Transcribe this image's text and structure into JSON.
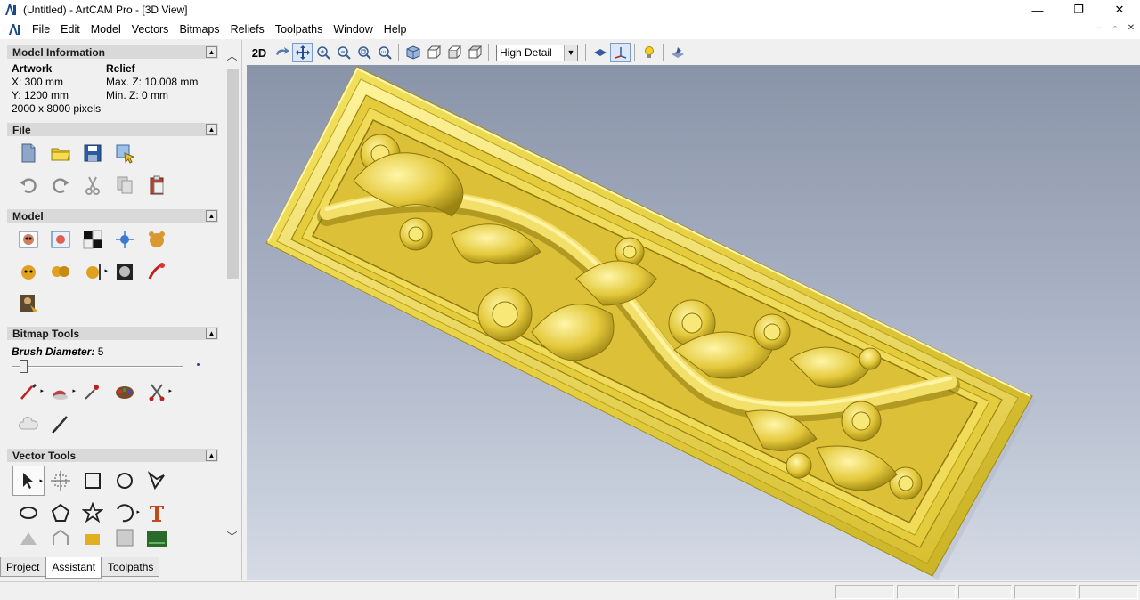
{
  "window": {
    "title": "(Untitled) - ArtCAM Pro - [3D View]",
    "minimize": "—",
    "maximize": "❐",
    "close": "✕"
  },
  "menu": [
    "File",
    "Edit",
    "Model",
    "Vectors",
    "Bitmaps",
    "Reliefs",
    "Toolpaths",
    "Window",
    "Help"
  ],
  "mdi_buttons": [
    "–",
    "▫",
    "✕"
  ],
  "model_info": {
    "header": "Model Information",
    "artwork_head": "Artwork",
    "artwork_x": "X: 300 mm",
    "artwork_y": "Y: 1200 mm",
    "relief_head": "Relief",
    "relief_max": "Max. Z: 10.008 mm",
    "relief_min": "Min. Z: 0 mm",
    "pixels": "2000 x 8000 pixels"
  },
  "sections": {
    "file": "File",
    "model": "Model",
    "bitmap_tools": "Bitmap Tools",
    "vector_tools": "Vector Tools"
  },
  "collapse_glyph": "▲",
  "brush": {
    "label": "Brush Diameter:",
    "value": "5",
    "level": 0.05
  },
  "tabs": [
    "Project",
    "Assistant",
    "Toolpaths"
  ],
  "toolbar": {
    "view_2d": "2D",
    "detail_select": "High Detail"
  },
  "icons": {
    "file": [
      "new-file-icon",
      "open-folder-icon",
      "save-icon",
      "import-icon",
      "undo-icon",
      "redo-icon",
      "cut-icon",
      "copy-icon",
      "paste-icon"
    ],
    "model": [
      "model-size-icon",
      "model-resolution-icon",
      "checker-icon",
      "position-icon",
      "bear-relief-icon",
      "relief-bear-icon",
      "relief-tile-icon",
      "relief-flip-icon",
      "grayscale-icon",
      "paint-icon",
      "mona-lisa-icon"
    ],
    "bitmap": [
      "pen-icon",
      "brush-icon",
      "dropper-icon",
      "palette-icon",
      "scissors-icon",
      "eraser-cloud-icon",
      "pencil-icon"
    ],
    "vector": [
      "select-arrow-icon",
      "transform-icon",
      "rectangle-icon",
      "circle-icon",
      "polyline-icon",
      "ellipse-icon",
      "polygon-icon",
      "star-icon",
      "arc-icon",
      "text-icon"
    ]
  },
  "colors": {
    "relief_gold": "#e8d24a",
    "relief_dark": "#b39a1c",
    "viewport_top": "#8a94a8",
    "viewport_bottom": "#d6dbe5"
  }
}
